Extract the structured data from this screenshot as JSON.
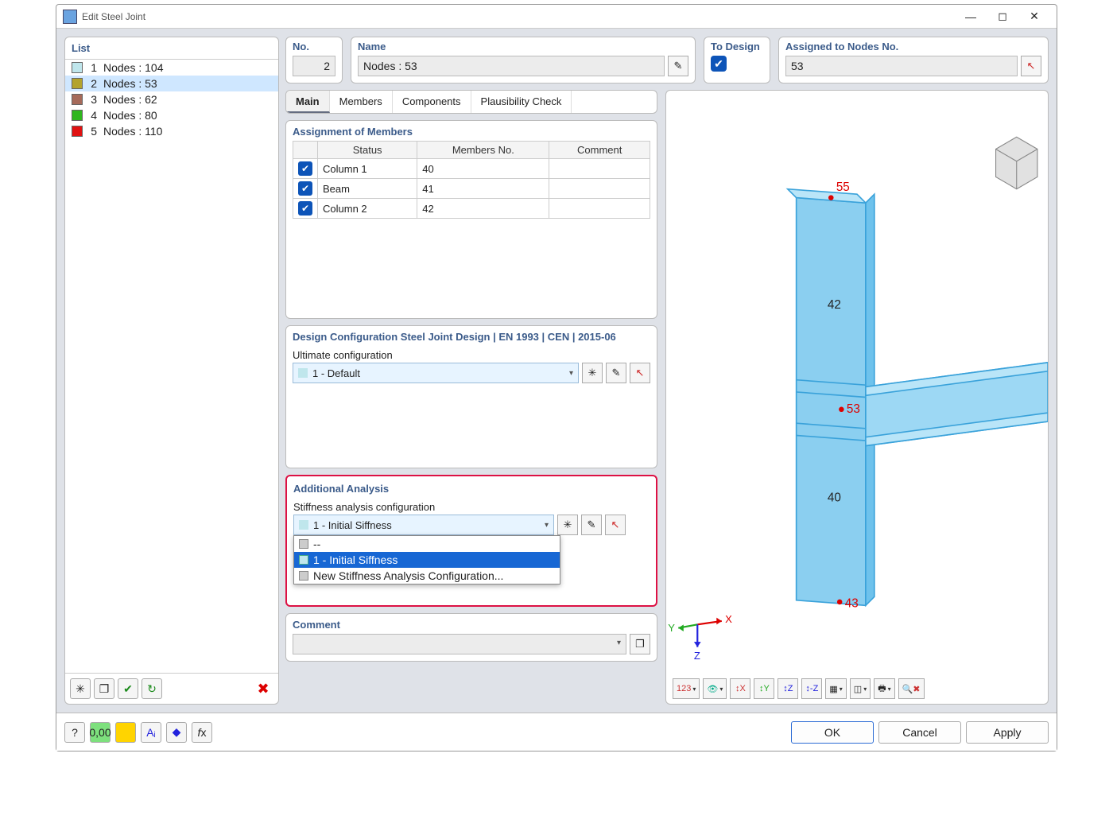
{
  "window_title": "Edit Steel Joint",
  "list": {
    "title": "List",
    "items": [
      {
        "idx": "1",
        "label": "Nodes : 104",
        "color": "#bfe6ec"
      },
      {
        "idx": "2",
        "label": "Nodes : 53",
        "color": "#b3a32d",
        "selected": true
      },
      {
        "idx": "3",
        "label": "Nodes : 62",
        "color": "#a66a5a"
      },
      {
        "idx": "4",
        "label": "Nodes : 80",
        "color": "#2fb61e"
      },
      {
        "idx": "5",
        "label": "Nodes : 110",
        "color": "#e01212"
      }
    ]
  },
  "header": {
    "no_label": "No.",
    "no_value": "2",
    "name_label": "Name",
    "name_value": "Nodes : 53",
    "to_design_label": "To Design",
    "to_design_checked": true,
    "assigned_label": "Assigned to Nodes No.",
    "assigned_value": "53"
  },
  "tabs": [
    "Main",
    "Members",
    "Components",
    "Plausibility Check"
  ],
  "assignment": {
    "title": "Assignment of Members",
    "headers": [
      "Status",
      "Members No.",
      "Comment"
    ],
    "rows": [
      {
        "status": "Column 1",
        "no": "40",
        "comment": ""
      },
      {
        "status": "Beam",
        "no": "41",
        "comment": ""
      },
      {
        "status": "Column 2",
        "no": "42",
        "comment": ""
      }
    ]
  },
  "design_config": {
    "title": "Design Configuration Steel Joint Design | EN 1993 | CEN | 2015-06",
    "sub": "Ultimate configuration",
    "value": "1 - Default"
  },
  "additional": {
    "title": "Additional Analysis",
    "sub": "Stiffness analysis configuration",
    "value": "1 - Initial Siffness",
    "options": [
      "--",
      "1 - Initial Siffness",
      "New Stiffness Analysis Configuration..."
    ],
    "selected_index": 1
  },
  "comment": {
    "title": "Comment",
    "value": ""
  },
  "preview_labels": {
    "n55": "55",
    "n42": "42",
    "n53": "53",
    "n40": "40",
    "n43": "43"
  },
  "axis_labels": {
    "x": "X",
    "y": "Y",
    "z": "Z"
  },
  "buttons": {
    "ok": "OK",
    "cancel": "Cancel",
    "apply": "Apply"
  }
}
